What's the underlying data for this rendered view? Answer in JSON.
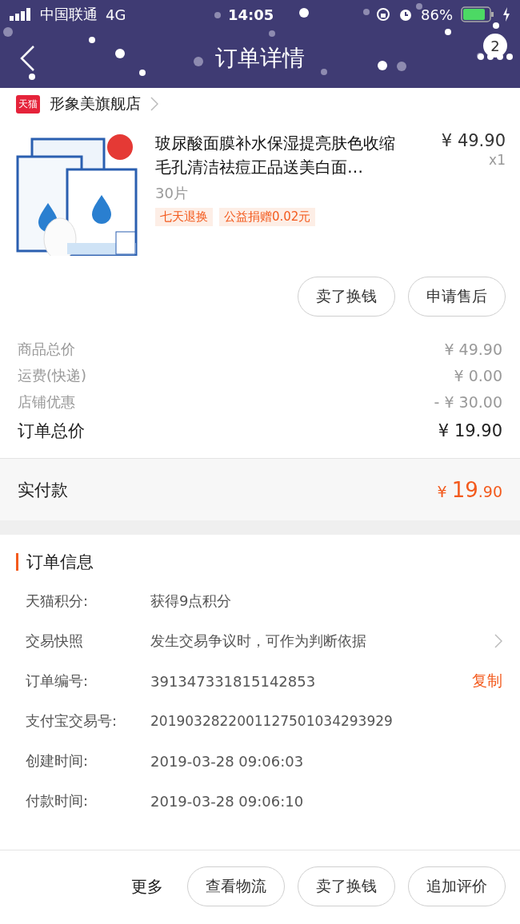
{
  "status_bar": {
    "carrier": "中国联通",
    "network": "4G",
    "time": "14:05",
    "battery": "86%"
  },
  "nav": {
    "title": "订单详情",
    "badge": "2"
  },
  "shop": {
    "logo": "天猫",
    "name": "形象美旗舰店"
  },
  "product": {
    "title": "玻尿酸面膜补水保湿提亮肤色收缩毛孔清洁祛痘正品送美白面…",
    "spec": "30片",
    "price": "¥ 49.90",
    "quantity": "x1",
    "tags": [
      "七天退换",
      "公益捐赠0.02元"
    ],
    "buttons": [
      "卖了换钱",
      "申请售后"
    ]
  },
  "costs": [
    {
      "label": "商品总价",
      "value": "¥ 49.90"
    },
    {
      "label": "运费(快递)",
      "value": "¥ 0.00"
    },
    {
      "label": "店铺优惠",
      "value": "- ¥ 30.00"
    }
  ],
  "total": {
    "label": "订单总价",
    "value": "¥ 19.90"
  },
  "paid": {
    "label": "实付款",
    "currency": "¥ ",
    "integer": "19",
    "decimal": ".90"
  },
  "info": {
    "title": "订单信息",
    "rows": [
      {
        "label": "天猫积分:",
        "value": "获得9点积分"
      },
      {
        "label": "交易快照",
        "value": "发生交易争议时，可作为判断依据",
        "link": true
      },
      {
        "label": "订单编号:",
        "value": "391347331815142853",
        "action": "复制"
      },
      {
        "label": "支付宝交易号:",
        "value": "2019032822001127501034293929"
      },
      {
        "label": "创建时间:",
        "value": "2019-03-28 09:06:03"
      },
      {
        "label": "付款时间:",
        "value": "2019-03-28 09:06:10"
      }
    ]
  },
  "footer": {
    "more": "更多",
    "buttons": [
      "查看物流",
      "卖了换钱",
      "追加评价"
    ]
  }
}
